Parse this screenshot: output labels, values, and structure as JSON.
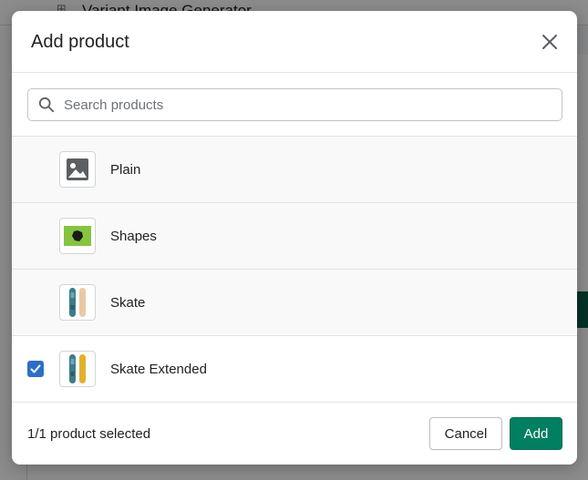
{
  "background": {
    "app_title": "Variant Image Generator"
  },
  "modal": {
    "title": "Add product",
    "search": {
      "placeholder": "Search products",
      "value": ""
    },
    "products": [
      {
        "label": "Plain",
        "selected": false,
        "thumb": "placeholder-image-icon"
      },
      {
        "label": "Shapes",
        "selected": false,
        "thumb": "shapes-image"
      },
      {
        "label": "Skate",
        "selected": false,
        "thumb": "skateboards-image"
      },
      {
        "label": "Skate Extended",
        "selected": true,
        "thumb": "skateboards-yellow-image"
      }
    ],
    "footer": {
      "status": "1/1 product selected",
      "cancel_label": "Cancel",
      "add_label": "Add"
    }
  },
  "colors": {
    "primary": "#008060",
    "checkbox": "#2c6ecb",
    "shapes_green": "#86c440"
  }
}
